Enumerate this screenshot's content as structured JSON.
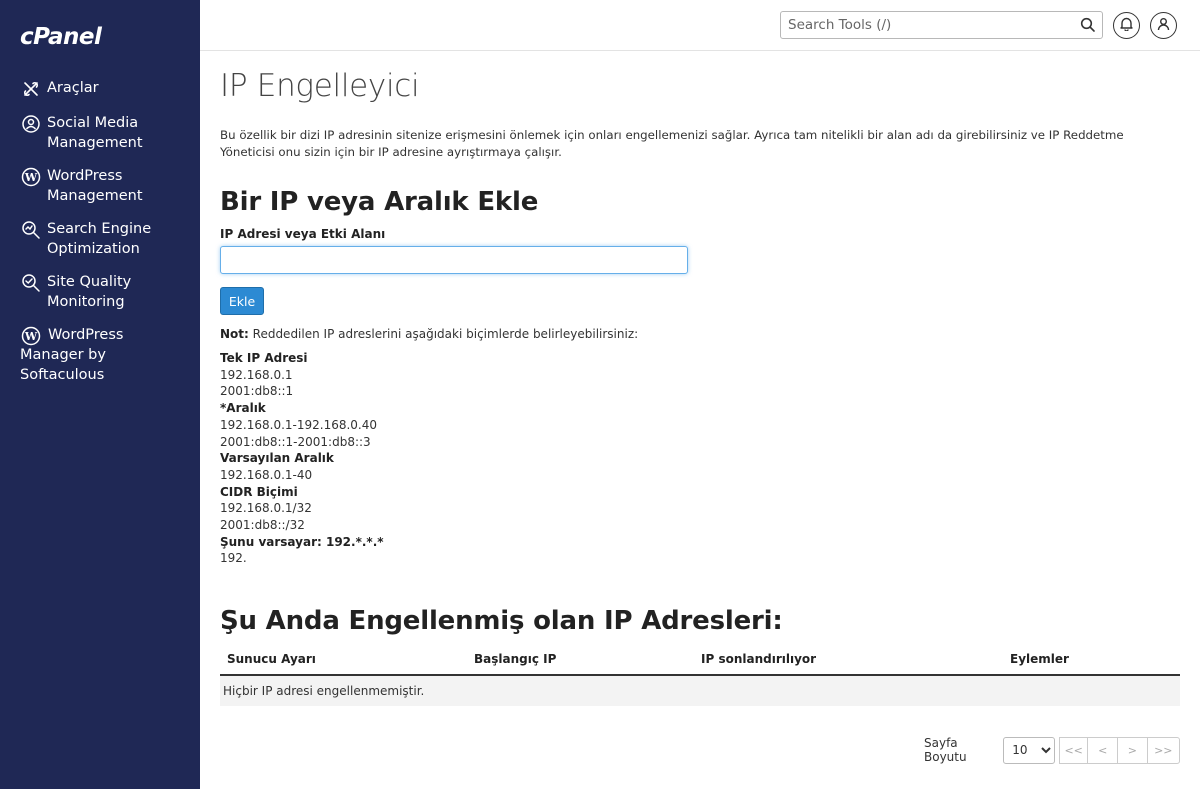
{
  "app": {
    "logo_text": "cPanel"
  },
  "sidebar": {
    "items": [
      {
        "label": "Araçlar",
        "icon": "tools-icon"
      },
      {
        "label": "Social Media Management",
        "icon": "social-media-icon"
      },
      {
        "label": "WordPress Management",
        "icon": "wordpress-icon"
      },
      {
        "label": "Search Engine Optimization",
        "icon": "seo-icon"
      },
      {
        "label": "Site Quality Monitoring",
        "icon": "site-quality-icon"
      },
      {
        "label": "WordPress Manager by Softaculous",
        "icon": "wordpress-icon"
      }
    ]
  },
  "topbar": {
    "search_placeholder": "Search Tools (/)"
  },
  "main": {
    "title": "IP Engelleyici",
    "description": "Bu özellik bir dizi IP adresinin sitenize erişmesini önlemek için onları engellemenizi sağlar. Ayrıca tam nitelikli bir alan adı da girebilirsiniz ve IP Reddetme Yöneticisi onu sizin için bir IP adresine ayrıştırmaya çalışır.",
    "add_heading": "Bir IP veya Aralık Ekle",
    "field_label": "IP Adresi veya Etki Alanı",
    "field_value": "",
    "add_button": "Ekle",
    "note_label": "Not:",
    "note_text": " Reddedilen IP adreslerini aşağıdaki biçimlerde belirleyebilirsiniz:",
    "formats": [
      {
        "heading": "Tek IP Adresi",
        "examples": [
          "192.168.0.1",
          "2001:db8::1"
        ]
      },
      {
        "heading": "*Aralık",
        "examples": [
          "192.168.0.1-192.168.0.40",
          "2001:db8::1-2001:db8::3"
        ]
      },
      {
        "heading": "Varsayılan Aralık",
        "examples": [
          "192.168.0.1-40"
        ]
      },
      {
        "heading": "CIDR Biçimi",
        "examples": [
          "192.168.0.1/32",
          "2001:db8::/32"
        ]
      },
      {
        "heading": "Şunu varsayar: 192.*.*.*",
        "examples": [
          "192."
        ]
      }
    ],
    "blocked_heading": "Şu Anda Engellenmiş olan IP Adresleri:",
    "table": {
      "columns": [
        "Sunucu Ayarı",
        "Başlangıç IP",
        "IP sonlandırılıyor",
        "Eylemler"
      ],
      "empty_message": "Hiçbir IP adresi engellenmemiştir."
    },
    "pagination": {
      "page_size_label": "Sayfa Boyutu",
      "page_size_value": "10",
      "page_size_options": [
        "10"
      ],
      "first": "<<",
      "prev": "<",
      "next": ">",
      "last": ">>"
    }
  }
}
